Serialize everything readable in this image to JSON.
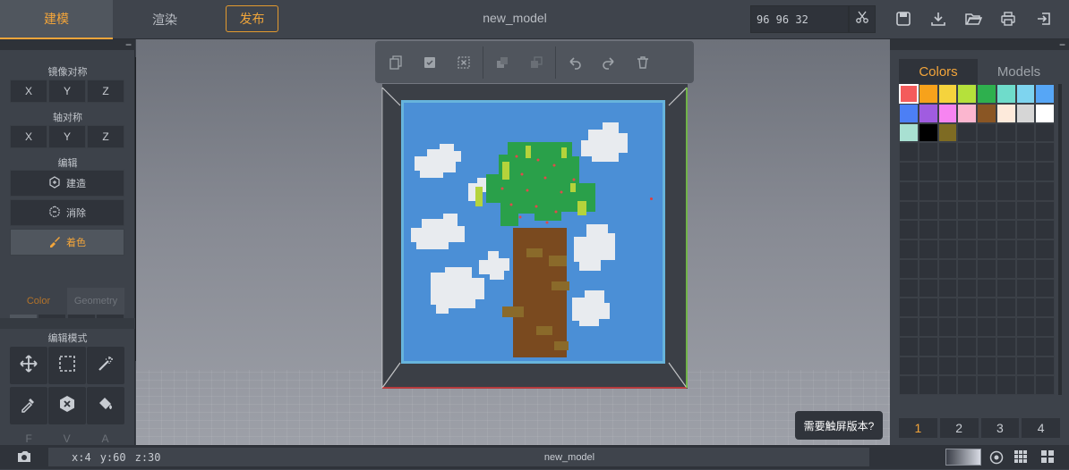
{
  "topbar": {
    "tabs": [
      {
        "label": "建模"
      },
      {
        "label": "渲染"
      }
    ],
    "publish_label": "发布",
    "model_name": "new_model",
    "size_value": "96  96  32"
  },
  "left_panel": {
    "mirror_label": "镜像对称",
    "axis_label": "轴对称",
    "axes": [
      "X",
      "Y",
      "Z"
    ],
    "edit_label": "编辑",
    "build_label": "建造",
    "erase_label": "消除",
    "paint_label": "着色",
    "color_mode": "Color",
    "geometry_mode": "Geometry",
    "edit_mode_label": "编辑模式",
    "bottom_letters": [
      "F",
      "V",
      "A"
    ]
  },
  "icons": {
    "paint": "brush-icon",
    "build": "cube-plus-icon",
    "erase": "cube-minus-icon"
  },
  "right_panel": {
    "tabs": [
      "Colors",
      "Models"
    ],
    "palette": [
      "#f45b5b",
      "#f7a21b",
      "#f5d33d",
      "#b5e13b",
      "#2eb04e",
      "#6fdccb",
      "#7ed4ef",
      "#56a6f6",
      "#4c7ff5",
      "#a05ce0",
      "#f784f1",
      "#fbb6cf",
      "#8a5624",
      "#fdeadb",
      "#d6d6d6",
      "#ffffff",
      "#a8e0d2",
      "#000000",
      "#7e6b23"
    ],
    "pages": [
      "1",
      "2",
      "3",
      "4"
    ]
  },
  "canvas": {
    "touch_tip": "需要触屏版本?"
  },
  "statusbar": {
    "x": "x:4",
    "y": "y:60",
    "z": "z:30",
    "model_name": "new_model"
  },
  "colors": {
    "accent": "#f3a53a",
    "sky": "#4b8fd6",
    "frame": "#67b4dc",
    "trunk": "#7a4a1f",
    "leaves": "#2aa04a",
    "cloud": "#e8ebef"
  }
}
